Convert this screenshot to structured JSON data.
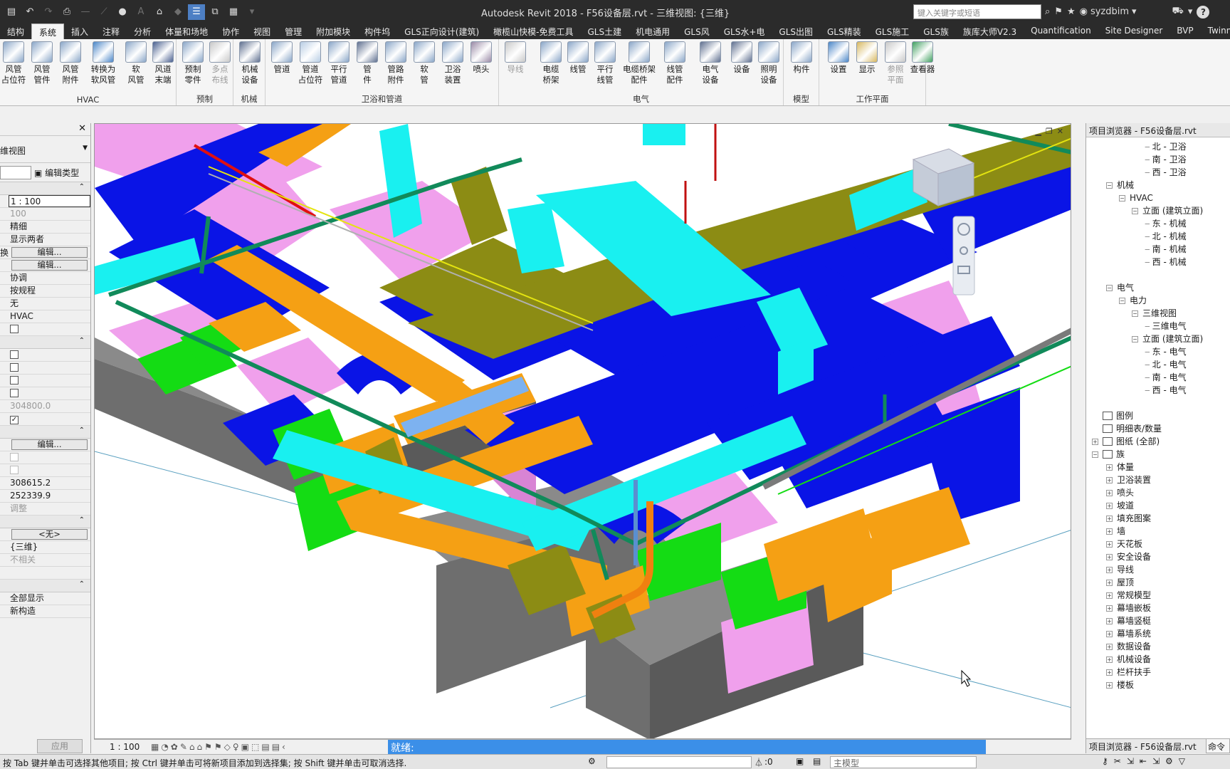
{
  "titlebar": {
    "title": "Autodesk Revit 2018 -    F56设备层.rvt - 三维视图: {三维}",
    "search_placeholder": "键入关键字或短语",
    "username": "syzdbim"
  },
  "ribbon_tabs": [
    "结构",
    "系统",
    "插入",
    "注释",
    "分析",
    "体量和场地",
    "协作",
    "视图",
    "管理",
    "附加模块",
    "构件坞",
    "GLS正向设计(建筑)",
    "橄榄山快模-免费工具",
    "GLS土建",
    "机电通用",
    "GLS风",
    "GLS水+电",
    "GLS出图",
    "GLS精装",
    "GLS施工",
    "GLS族",
    "族库大师V2.3",
    "Quantification",
    "Site Designer",
    "BVP",
    "Twinmotion"
  ],
  "active_tab": "系统",
  "ribbon_groups": {
    "hvac": {
      "title": "HVAC",
      "buttons": [
        "风管\n占位符",
        "风管\n管件",
        "风管\n附件",
        "转换为\n软风管",
        "软\n风管",
        "风道\n末端"
      ]
    },
    "prefab": {
      "title": "预制",
      "buttons": [
        "预制\n零件",
        "多点\n布线"
      ]
    },
    "mech": {
      "title": "机械",
      "buttons": [
        "机械\n设备"
      ]
    },
    "plumbing": {
      "title": "卫浴和管道",
      "buttons": [
        "管道",
        "管道\n占位符",
        "平行\n管道",
        "管\n件",
        "管路\n附件",
        "软\n管",
        "卫浴\n装置",
        "喷头"
      ]
    },
    "electrical": {
      "title": "电气",
      "buttons": [
        "导线",
        "电缆\n桥架",
        "线管",
        "平行\n线管",
        "电缆桥架\n配件",
        "线管\n配件",
        "电气\n设备",
        "设备",
        "照明\n设备"
      ]
    },
    "model": {
      "title": "模型",
      "buttons": [
        "构件"
      ]
    },
    "workplane": {
      "title": "工作平面",
      "buttons": [
        "设置",
        "显示",
        "参照\n平面",
        "查看器"
      ]
    }
  },
  "properties": {
    "type_name": "维视图",
    "edit_type": "编辑类型",
    "rows": [
      {
        "kind": "sec"
      },
      {
        "kind": "box",
        "value": "1 : 100"
      },
      {
        "kind": "grey",
        "value": "100"
      },
      {
        "kind": "text",
        "value": "精细"
      },
      {
        "kind": "text",
        "value": "显示两者"
      },
      {
        "kind": "btn",
        "label": "换",
        "value": "编辑..."
      },
      {
        "kind": "btn",
        "value": "编辑..."
      },
      {
        "kind": "text",
        "value": "协调"
      },
      {
        "kind": "text",
        "value": "按规程"
      },
      {
        "kind": "text",
        "value": "无"
      },
      {
        "kind": "text",
        "value": "HVAC"
      },
      {
        "kind": "cb",
        "value": ""
      },
      {
        "kind": "sec"
      },
      {
        "kind": "cb",
        "value": ""
      },
      {
        "kind": "cb",
        "value": ""
      },
      {
        "kind": "cb",
        "value": ""
      },
      {
        "kind": "cb",
        "value": ""
      },
      {
        "kind": "grey",
        "value": "304800.0"
      },
      {
        "kind": "cbon",
        "value": "✓"
      },
      {
        "kind": "sec"
      },
      {
        "kind": "btn",
        "value": "编辑..."
      },
      {
        "kind": "cbgrey",
        "value": ""
      },
      {
        "kind": "cbgrey",
        "value": ""
      },
      {
        "kind": "text",
        "value": "308615.2"
      },
      {
        "kind": "text",
        "value": "252339.9"
      },
      {
        "kind": "grey",
        "value": "调整"
      },
      {
        "kind": "sec"
      },
      {
        "kind": "btn",
        "value": "<无>"
      },
      {
        "kind": "text",
        "value": "{三维}"
      },
      {
        "kind": "grey",
        "value": "不相关"
      },
      {
        "kind": "text",
        "value": ""
      },
      {
        "kind": "sec"
      },
      {
        "kind": "text",
        "value": "全部显示"
      },
      {
        "kind": "text",
        "value": "新构造"
      }
    ],
    "apply": "应用"
  },
  "viewbar": {
    "scale": "1 : 100",
    "status": "就绪:"
  },
  "browser": {
    "title": "项目浏览器 - F56设备层.rvt",
    "footer": "项目浏览器 - F56设备层.rvt",
    "cmd_tab": "命令",
    "nodes": [
      {
        "level": 4,
        "label": "北 - 卫浴",
        "exp": ""
      },
      {
        "level": 4,
        "label": "南 - 卫浴",
        "exp": ""
      },
      {
        "level": 4,
        "label": "西 - 卫浴",
        "exp": ""
      },
      {
        "level": 1,
        "label": "机械",
        "exp": "−"
      },
      {
        "level": 2,
        "label": "HVAC",
        "exp": "−"
      },
      {
        "level": 3,
        "label": "立面 (建筑立面)",
        "exp": "−"
      },
      {
        "level": 4,
        "label": "东 - 机械",
        "exp": ""
      },
      {
        "level": 4,
        "label": "北 - 机械",
        "exp": ""
      },
      {
        "level": 4,
        "label": "南 - 机械",
        "exp": ""
      },
      {
        "level": 4,
        "label": "西 - 机械",
        "exp": ""
      },
      {
        "level": 99,
        "label": "",
        "exp": ""
      },
      {
        "level": 1,
        "label": "电气",
        "exp": "−"
      },
      {
        "level": 2,
        "label": "电力",
        "exp": "−"
      },
      {
        "level": 3,
        "label": "三维视图",
        "exp": "−"
      },
      {
        "level": 4,
        "label": "三维电气",
        "exp": ""
      },
      {
        "level": 3,
        "label": "立面 (建筑立面)",
        "exp": "−"
      },
      {
        "level": 4,
        "label": "东 - 电气",
        "exp": ""
      },
      {
        "level": 4,
        "label": "北 - 电气",
        "exp": ""
      },
      {
        "level": 4,
        "label": "南 - 电气",
        "exp": ""
      },
      {
        "level": 4,
        "label": "西 - 电气",
        "exp": ""
      },
      {
        "level": 99,
        "label": "",
        "exp": ""
      },
      {
        "level": 0,
        "label": "图例",
        "exp": "",
        "icon": true
      },
      {
        "level": 0,
        "label": "明细表/数量",
        "exp": "",
        "icon": true
      },
      {
        "level": 0,
        "label": "图纸 (全部)",
        "exp": "+",
        "icon": true
      },
      {
        "level": 0,
        "label": "族",
        "exp": "−",
        "icon": true
      },
      {
        "level": 1,
        "label": "体量",
        "exp": "+"
      },
      {
        "level": 1,
        "label": "卫浴装置",
        "exp": "+"
      },
      {
        "level": 1,
        "label": "喷头",
        "exp": "+"
      },
      {
        "level": 1,
        "label": "坡道",
        "exp": "+"
      },
      {
        "level": 1,
        "label": "填充图案",
        "exp": "+"
      },
      {
        "level": 1,
        "label": "墙",
        "exp": "+"
      },
      {
        "level": 1,
        "label": "天花板",
        "exp": "+"
      },
      {
        "level": 1,
        "label": "安全设备",
        "exp": "+"
      },
      {
        "level": 1,
        "label": "导线",
        "exp": "+"
      },
      {
        "level": 1,
        "label": "屋顶",
        "exp": "+"
      },
      {
        "level": 1,
        "label": "常规模型",
        "exp": "+"
      },
      {
        "level": 1,
        "label": "幕墙嵌板",
        "exp": "+"
      },
      {
        "level": 1,
        "label": "幕墙竖梃",
        "exp": "+"
      },
      {
        "level": 1,
        "label": "幕墙系统",
        "exp": "+"
      },
      {
        "level": 1,
        "label": "数据设备",
        "exp": "+"
      },
      {
        "level": 1,
        "label": "机械设备",
        "exp": "+"
      },
      {
        "level": 1,
        "label": "栏杆扶手",
        "exp": "+"
      },
      {
        "level": 1,
        "label": "楼板",
        "exp": "+"
      }
    ]
  },
  "statusbar": {
    "hint": "按 Tab 键并单击可选择其他项目; 按 Ctrl 键并单击可将新项目添加到选择集; 按 Shift 键并单击可取消选择.",
    "count": ":0",
    "model": "主模型"
  },
  "colors": {
    "duct_blue": "#0a14e6",
    "duct_cyan": "#19f0f0",
    "duct_pink": "#f0a0ec",
    "duct_olive": "#8c8c14",
    "duct_orange": "#f5a014",
    "pipe_green": "#118a5a",
    "equip_green": "#14dc14",
    "slab_grey": "#7a7a7a",
    "status_blue": "#3b8fe8"
  }
}
